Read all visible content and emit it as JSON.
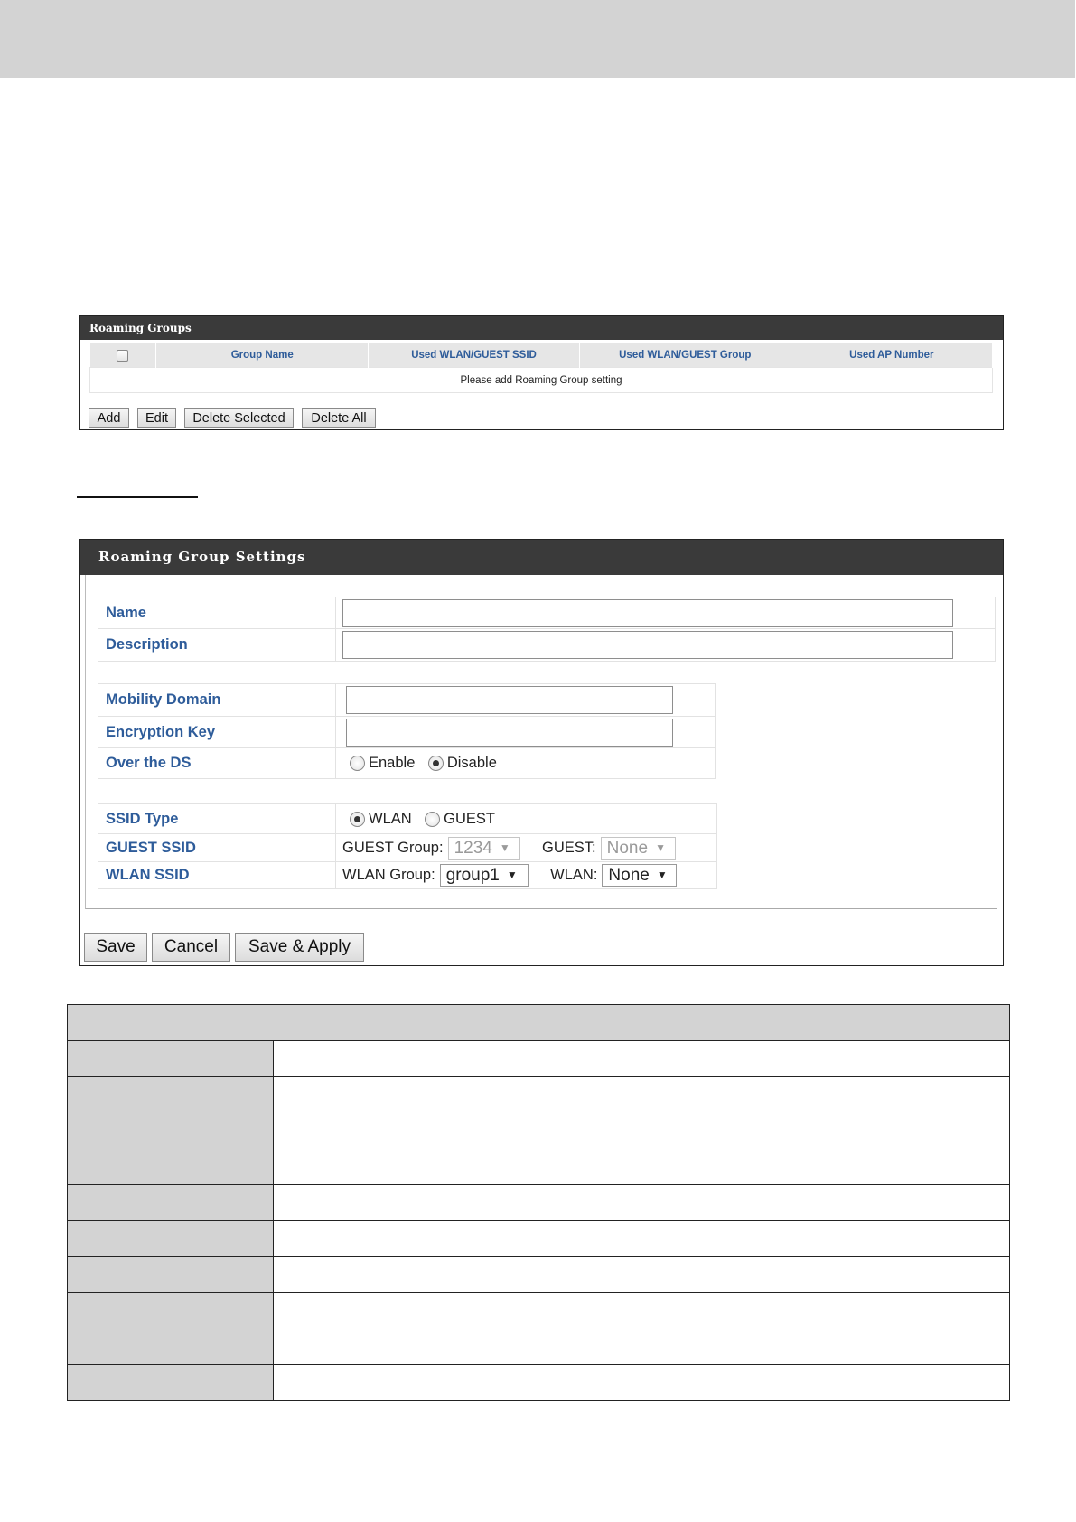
{
  "roaming_groups": {
    "title": "Roaming Groups",
    "columns": [
      "Group Name",
      "Used WLAN/GUEST SSID",
      "Used WLAN/GUEST Group",
      "Used AP Number"
    ],
    "empty_message": "Please add Roaming Group setting",
    "buttons": {
      "add": "Add",
      "edit": "Edit",
      "delete_selected": "Delete Selected",
      "delete_all": "Delete All"
    }
  },
  "settings": {
    "title": "Roaming Group Settings",
    "fields": {
      "name": {
        "label": "Name",
        "value": ""
      },
      "description": {
        "label": "Description",
        "value": ""
      },
      "mobility_domain": {
        "label": "Mobility Domain",
        "value": ""
      },
      "encryption_key": {
        "label": "Encryption Key",
        "value": ""
      },
      "over_the_ds": {
        "label": "Over the DS",
        "enable": "Enable",
        "disable": "Disable",
        "selected": "Disable"
      },
      "ssid_type": {
        "label": "SSID Type",
        "wlan": "WLAN",
        "guest": "GUEST",
        "selected": "WLAN"
      },
      "guest_ssid": {
        "label": "GUEST SSID",
        "group_label": "GUEST Group:",
        "group_value": "1234",
        "ssid_label": "GUEST:",
        "ssid_value": "None"
      },
      "wlan_ssid": {
        "label": "WLAN SSID",
        "group_label": "WLAN Group:",
        "group_value": "group1",
        "ssid_label": "WLAN:",
        "ssid_value": "None"
      }
    },
    "buttons": {
      "save": "Save",
      "cancel": "Cancel",
      "save_apply": "Save & Apply"
    }
  },
  "icons": {
    "dropdown": "chevron-down-icon",
    "arrow_glyph": "▼"
  }
}
